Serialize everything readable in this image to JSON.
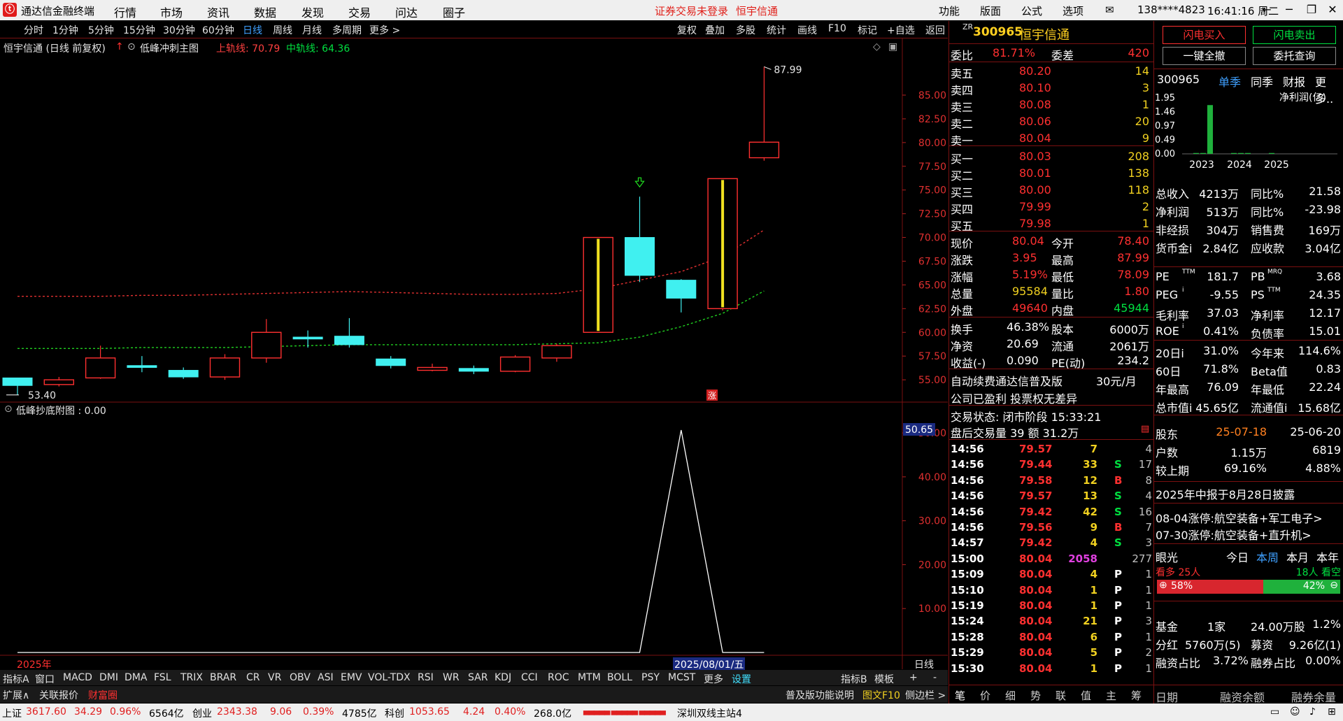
{
  "menubar": {
    "app_title": "通达信金融终端",
    "menus": [
      "行情",
      "市场",
      "资讯",
      "数据",
      "发现",
      "交易",
      "问达",
      "圈子"
    ],
    "notice_login": "证券交易未登录",
    "notice_stock": "恒宇信通",
    "right_items": [
      "功能",
      "版面",
      "公式",
      "选项"
    ],
    "phone": "138****4823",
    "clock": "16:41:16 周二"
  },
  "periods": [
    "分时",
    "1分钟",
    "5分钟",
    "15分钟",
    "30分钟",
    "60分钟",
    "日线",
    "周线",
    "月线",
    "多周期",
    "更多 >"
  ],
  "active_period": "日线",
  "tools": [
    "复权",
    "叠加",
    "多股",
    "统计",
    "画线",
    "F10",
    "标记",
    "+自选",
    "返回"
  ],
  "chart": {
    "title": "恒宇信通 (日线 前复权)",
    "indicator_name": "低峰冲刺主图",
    "upper_rail_label": "上轨线: 70.79",
    "mid_rail_label": "中轨线: 64.36",
    "high_marker": "87.99",
    "low_marker": "53.40",
    "zhang_marker": "涨",
    "year_label": "2025年",
    "date_label": "2025/08/01/五",
    "period_label": "日线"
  },
  "chart_data": [
    {
      "type": "candlestick",
      "title": "恒宇信通 (日线 前复权)",
      "ylim": [
        53,
        90
      ],
      "y_ticks": [
        55.0,
        57.5,
        60.0,
        62.5,
        65.0,
        67.5,
        70.0,
        72.5,
        75.0,
        77.5,
        80.0,
        82.5,
        85.0
      ],
      "candles": [
        {
          "o": 55.2,
          "c": 54.4,
          "h": 55.2,
          "l": 53.4
        },
        {
          "o": 54.5,
          "c": 55.0,
          "h": 55.3,
          "l": 54.3
        },
        {
          "o": 55.2,
          "c": 57.3,
          "h": 58.6,
          "l": 55.1
        },
        {
          "o": 56.5,
          "c": 56.3,
          "h": 57.5,
          "l": 55.8
        },
        {
          "o": 56.0,
          "c": 55.3,
          "h": 56.3,
          "l": 55.1
        },
        {
          "o": 55.3,
          "c": 57.3,
          "h": 57.7,
          "l": 55.0
        },
        {
          "o": 57.3,
          "c": 60.0,
          "h": 61.4,
          "l": 56.8
        },
        {
          "o": 59.5,
          "c": 59.3,
          "h": 60.2,
          "l": 58.4
        },
        {
          "o": 59.6,
          "c": 58.7,
          "h": 61.5,
          "l": 58.4
        },
        {
          "o": 57.2,
          "c": 56.5,
          "h": 57.5,
          "l": 56.2
        },
        {
          "o": 56.0,
          "c": 56.3,
          "h": 56.7,
          "l": 55.9
        },
        {
          "o": 56.2,
          "c": 55.9,
          "h": 56.5,
          "l": 55.6
        },
        {
          "o": 55.9,
          "c": 57.4,
          "h": 57.6,
          "l": 55.8
        },
        {
          "o": 57.3,
          "c": 58.6,
          "h": 58.8,
          "l": 56.9
        },
        {
          "o": 60.0,
          "c": 70.0,
          "h": 70.0,
          "l": 60.0
        },
        {
          "o": 70.0,
          "c": 66.0,
          "h": 74.3,
          "l": 65.3
        },
        {
          "o": 65.5,
          "c": 63.6,
          "h": 65.6,
          "l": 62.1
        },
        {
          "o": 62.5,
          "c": 76.2,
          "h": 76.2,
          "l": 62.3
        },
        {
          "o": 78.4,
          "c": 80.04,
          "h": 87.99,
          "l": 78.09
        }
      ],
      "upper_rail_last": 70.79,
      "mid_rail_last": 64.36
    },
    {
      "type": "line",
      "title": "低峰抄底附图 : 0.00",
      "ylim": [
        0,
        50.65
      ],
      "y_ticks": [
        10.0,
        20.0,
        30.0,
        40.0,
        50.0
      ],
      "current_value_label": "50.65",
      "values": [
        0,
        0,
        0,
        0,
        0,
        0,
        0,
        0,
        0,
        0,
        0,
        0,
        0,
        0,
        0,
        0,
        50.65,
        0,
        0
      ]
    }
  ],
  "indicator_tabs": [
    "指标A",
    "窗口",
    "MACD",
    "DMI",
    "DMA",
    "FSL",
    "TRIX",
    "BRAR",
    "CR",
    "VR",
    "OBV",
    "ASI",
    "EMV",
    "VOL-TDX",
    "RSI",
    "WR",
    "SAR",
    "KDJ",
    "CCI",
    "ROC",
    "MTM",
    "BOLL",
    "PSY",
    "MCST",
    "更多",
    "设置"
  ],
  "indicator_b": [
    "指标B",
    "模板",
    "+",
    "-"
  ],
  "ext_tabs": [
    "扩展∧",
    "关联报价",
    "财富圈"
  ],
  "ext_right": [
    "普及版功能说明",
    "图文F10",
    "侧边栏 >"
  ],
  "status": {
    "sh_label": "上证",
    "sh_val": "3617.60",
    "sh_chg": "34.29",
    "sh_pct": "0.96%",
    "sh_amt": "6564亿",
    "cy_label": "创业",
    "cy_val": "2343.38",
    "cy_chg": "9.06",
    "cy_pct": "0.39%",
    "cy_amt": "4785亿",
    "kc_label": "科创",
    "kc_val": "1053.65",
    "kc_chg": "4.24",
    "kc_pct": "0.40%",
    "kc_amt": "268.0亿",
    "station": "深圳双线主站4"
  },
  "quote": {
    "code": "300965",
    "name": "恒宇信通",
    "prefix": "ZR",
    "webi_label": "委比",
    "webi": "81.71%",
    "weicha_label": "委差",
    "weicha": "420",
    "sells": [
      {
        "label": "卖五",
        "price": "80.20",
        "vol": "14"
      },
      {
        "label": "卖四",
        "price": "80.10",
        "vol": "3"
      },
      {
        "label": "卖三",
        "price": "80.08",
        "vol": "1"
      },
      {
        "label": "卖二",
        "price": "80.06",
        "vol": "20"
      },
      {
        "label": "卖一",
        "price": "80.04",
        "vol": "9"
      }
    ],
    "buys": [
      {
        "label": "买一",
        "price": "80.03",
        "vol": "208"
      },
      {
        "label": "买二",
        "price": "80.01",
        "vol": "138"
      },
      {
        "label": "买三",
        "price": "80.00",
        "vol": "118"
      },
      {
        "label": "买四",
        "price": "79.99",
        "vol": "2"
      },
      {
        "label": "买五",
        "price": "79.98",
        "vol": "1"
      }
    ],
    "stats": [
      {
        "l1": "现价",
        "v1": "80.04",
        "l2": "今开",
        "v2": "78.40"
      },
      {
        "l1": "涨跌",
        "v1": "3.95",
        "l2": "最高",
        "v2": "87.99"
      },
      {
        "l1": "涨幅",
        "v1": "5.19%",
        "l2": "最低",
        "v2": "78.09"
      },
      {
        "l1": "总量",
        "v1": "95584",
        "l2": "量比",
        "v2": "1.80"
      },
      {
        "l1": "外盘",
        "v1": "49640",
        "l2": "内盘",
        "v2": "45944"
      }
    ],
    "stats2": [
      {
        "l1": "换手",
        "v1": "46.38%",
        "l2": "股本",
        "v2": "6000万"
      },
      {
        "l1": "净资",
        "v1": "20.69",
        "l2": "流通",
        "v2": "2061万"
      },
      {
        "l1": "收益(-)",
        "v1": "0.090",
        "l2": "PE(动)",
        "v2": "234.2"
      }
    ],
    "promo1": "自动续费通达信普及版",
    "promo1_price": "30元/月",
    "promo2": "公司已盈利 投票权无差异",
    "trade_state": "交易状态: 闭市阶段 15:33:21",
    "after_hours": "盘后交易量 39 额 31.2万",
    "ticks": [
      {
        "t": "14:56",
        "p": "79.57",
        "v": "7",
        "f": "",
        "n": "4"
      },
      {
        "t": "14:56",
        "p": "79.44",
        "v": "33",
        "f": "S",
        "n": "17"
      },
      {
        "t": "14:56",
        "p": "79.58",
        "v": "12",
        "f": "B",
        "n": "8"
      },
      {
        "t": "14:56",
        "p": "79.57",
        "v": "13",
        "f": "S",
        "n": "4"
      },
      {
        "t": "14:56",
        "p": "79.42",
        "v": "42",
        "f": "S",
        "n": "16"
      },
      {
        "t": "14:56",
        "p": "79.56",
        "v": "9",
        "f": "B",
        "n": "7"
      },
      {
        "t": "14:57",
        "p": "79.42",
        "v": "4",
        "f": "S",
        "n": "3"
      },
      {
        "t": "15:00",
        "p": "80.04",
        "v": "2058",
        "f": "",
        "n": "277"
      },
      {
        "t": "15:09",
        "p": "80.04",
        "v": "4",
        "f": "P",
        "n": "1"
      },
      {
        "t": "15:10",
        "p": "80.04",
        "v": "1",
        "f": "P",
        "n": "1"
      },
      {
        "t": "15:19",
        "p": "80.04",
        "v": "1",
        "f": "P",
        "n": "1"
      },
      {
        "t": "15:24",
        "p": "80.04",
        "v": "21",
        "f": "P",
        "n": "3"
      },
      {
        "t": "15:28",
        "p": "80.04",
        "v": "6",
        "f": "P",
        "n": "1"
      },
      {
        "t": "15:29",
        "p": "80.04",
        "v": "5",
        "f": "P",
        "n": "2"
      },
      {
        "t": "15:30",
        "p": "80.04",
        "v": "1",
        "f": "P",
        "n": "1"
      }
    ],
    "bottom_tabs": [
      "笔",
      "价",
      "细",
      "势",
      "联",
      "值",
      "主",
      "筹"
    ]
  },
  "fpanel": {
    "btn_buy": "闪电买入",
    "btn_sell": "闪电卖出",
    "btn_cancel": "一键全撤",
    "btn_query": "委托查询",
    "code": "300965",
    "tabs": [
      "单季",
      "同季",
      "财报",
      "更多.."
    ],
    "metric": "净利润(亿)",
    "bar_ticks": [
      "1.95",
      "1.46",
      "0.97",
      "0.49",
      "0.00"
    ],
    "bar_years": [
      "2023",
      "2024",
      "2025"
    ],
    "bar_values": [
      0.03,
      0.03,
      1.7,
      0.03,
      0.03,
      0.03,
      0.03
    ],
    "fin": [
      {
        "l1": "总收入",
        "v1": "4213万",
        "l2": "同比%",
        "v2": "21.58"
      },
      {
        "l1": "净利润",
        "v1": "513万",
        "l2": "同比%",
        "v2": "-23.98"
      },
      {
        "l1": "非经损",
        "v1": "304万",
        "l2": "销售费",
        "v2": "169万"
      },
      {
        "l1": "货币金i",
        "v1": "2.84亿",
        "l2": "应收款",
        "v2": "3.04亿"
      }
    ],
    "val": [
      {
        "l1": "PE",
        "s1": "TTM",
        "v1": "181.7",
        "l2": "PB",
        "s2": "MRQ",
        "v2": "3.68"
      },
      {
        "l1": "PEG",
        "s1": "i",
        "v1": "-9.55",
        "l2": "PS",
        "s2": "TTM",
        "v2": "24.35"
      },
      {
        "l1": "毛利率",
        "s1": "",
        "v1": "37.03",
        "l2": "净利率",
        "s2": "",
        "v2": "12.17"
      },
      {
        "l1": "ROE",
        "s1": "i",
        "v1": "0.41%",
        "l2": "负债率",
        "s2": "",
        "v2": "15.01"
      }
    ],
    "perf": [
      {
        "l1": "20日i",
        "v1": "31.0%",
        "l2": "今年来",
        "v2": "114.6%"
      },
      {
        "l1": "60日",
        "v1": "71.8%",
        "l2": "Beta值",
        "v2": "0.83"
      },
      {
        "l1": "年最高",
        "v1": "76.09",
        "l2": "年最低",
        "v2": "22.24"
      },
      {
        "l1": "总市值i",
        "v1": "45.65亿",
        "l2": "流通值i",
        "v2": "15.68亿"
      }
    ],
    "holders": [
      {
        "l1": "股东",
        "v1": "25-07-18",
        "v2": "25-06-20"
      },
      {
        "l1": "户数",
        "v1": "1.15万",
        "v2": "6819"
      },
      {
        "l1": "较上期",
        "v1": "69.16%",
        "v2": "4.88%"
      }
    ],
    "report": "2025年中报于8月28日披露",
    "news1": "08-04涨停:航空装备+军工电子>",
    "news2": "07-30涨停:航空装备+直升机>",
    "eye": "眼光",
    "eye_tabs": [
      "今日",
      "本周",
      "本月",
      "本年"
    ],
    "bull_label": "看多 25人",
    "bear_label": "18人 看空",
    "bull_pct": 0.58,
    "bull_pct_label": "58%",
    "bear_pct_label": "42%",
    "fund": [
      {
        "l1": "基金",
        "v1": "1家",
        "v2": "24.00万股",
        "v3": "1.2%"
      },
      {
        "l1": "分红",
        "v1": "5760万(5)",
        "l2": "募资",
        "v2": "9.26亿(1)"
      },
      {
        "l1": "融资占比",
        "v1": "3.72%",
        "l2": "融券占比",
        "v2": "0.00%"
      }
    ],
    "footer": [
      "日期",
      "融资余额",
      "融券余量"
    ]
  }
}
